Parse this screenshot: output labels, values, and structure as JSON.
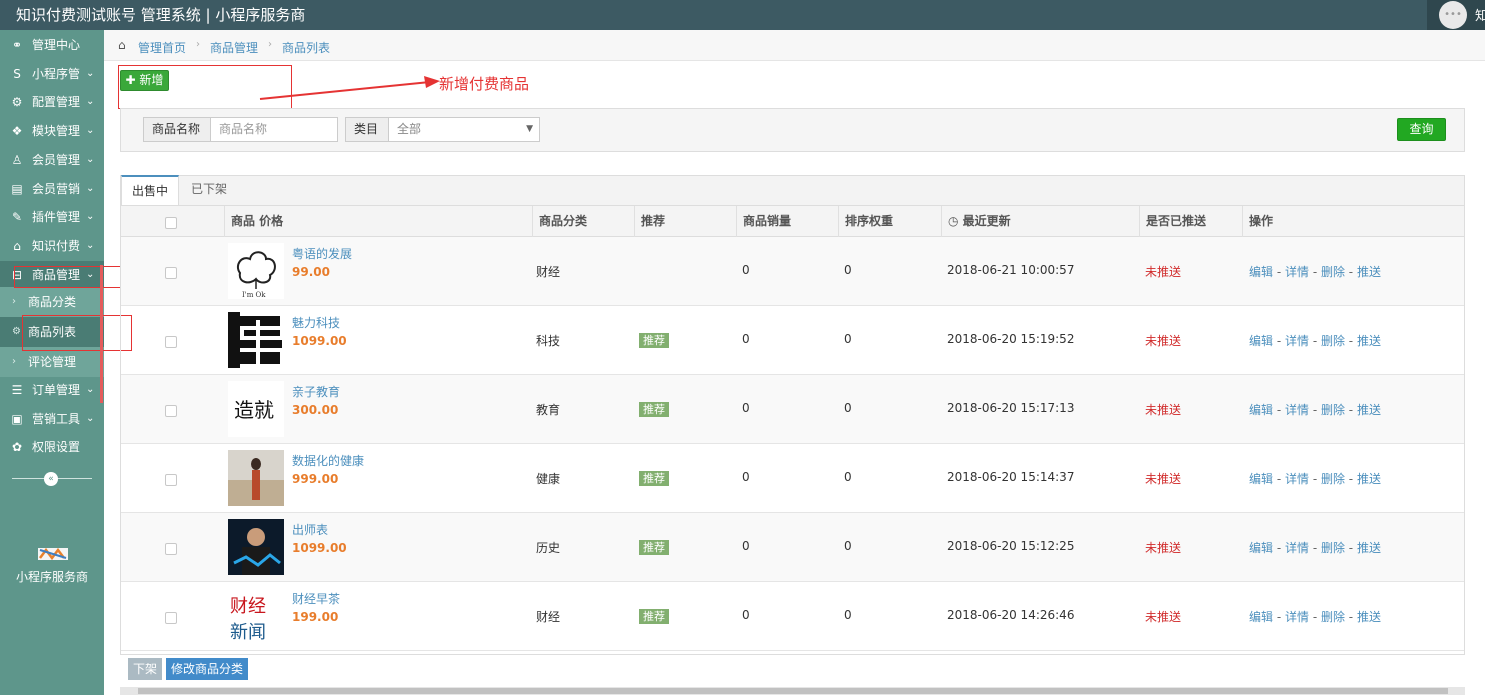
{
  "header": {
    "title": "知识付费测试账号 管理系统 | 小程序服务商",
    "user_initial": "知"
  },
  "sidebar": {
    "items": [
      {
        "label": "管理中心",
        "icon": "dashboard-icon",
        "glyph": "⚭"
      },
      {
        "label": "小程序管",
        "icon": "s-icon",
        "glyph": "S"
      },
      {
        "label": "配置管理",
        "icon": "gears-icon",
        "glyph": "⚙"
      },
      {
        "label": "模块管理",
        "icon": "cubes-icon",
        "glyph": "❖"
      },
      {
        "label": "会员管理",
        "icon": "user-icon",
        "glyph": "♙"
      },
      {
        "label": "会员营销",
        "icon": "card-icon",
        "glyph": "▤"
      },
      {
        "label": "插件管理",
        "icon": "wrench-icon",
        "glyph": "✎"
      },
      {
        "label": "知识付费",
        "icon": "home-icon",
        "glyph": "⌂"
      },
      {
        "label": "商品管理",
        "icon": "cart-icon",
        "glyph": "⊟"
      }
    ],
    "subitems": [
      {
        "label": "商品分类"
      },
      {
        "label": "商品列表"
      },
      {
        "label": "评论管理"
      }
    ],
    "items2": [
      {
        "label": "订单管理",
        "icon": "list-icon",
        "glyph": "☰"
      },
      {
        "label": "营销工具",
        "icon": "briefcase-icon",
        "glyph": "▣"
      },
      {
        "label": "权限设置",
        "icon": "cog-icon",
        "glyph": "✿"
      }
    ],
    "brand": "小程序服务商"
  },
  "breadcrumb": [
    "管理首页",
    "商品管理",
    "商品列表"
  ],
  "toolbar": {
    "add_label": "新增"
  },
  "annotation": {
    "text": "新增付费商品"
  },
  "search": {
    "name_label": "商品名称",
    "name_placeholder": "商品名称",
    "category_label": "类目",
    "category_value": "全部",
    "query_label": "查询"
  },
  "tabs": [
    "出售中",
    "已下架"
  ],
  "table": {
    "headers": [
      "商品 价格",
      "商品分类",
      "推荐",
      "商品销量",
      "排序权重",
      "最近更新",
      "是否已推送",
      "操作"
    ],
    "rows": [
      {
        "name": "粤语的发展",
        "price": "99.00",
        "category": "财经",
        "recommend": "",
        "sales": "0",
        "weight": "0",
        "updated": "2018-06-21 10:00:57",
        "pushed": "未推送",
        "thumb": "cloud"
      },
      {
        "name": "魅力科技",
        "price": "1099.00",
        "category": "科技",
        "recommend": "推荐",
        "sales": "0",
        "weight": "0",
        "updated": "2018-06-20 15:19:52",
        "pushed": "未推送",
        "thumb": "ink"
      },
      {
        "name": "亲子教育",
        "price": "300.00",
        "category": "教育",
        "recommend": "推荐",
        "sales": "0",
        "weight": "0",
        "updated": "2018-06-20 15:17:13",
        "pushed": "未推送",
        "thumb": "calligraphy"
      },
      {
        "name": "数据化的健康",
        "price": "999.00",
        "category": "健康",
        "recommend": "推荐",
        "sales": "0",
        "weight": "0",
        "updated": "2018-06-20 15:14:37",
        "pushed": "未推送",
        "thumb": "beach"
      },
      {
        "name": "出师表",
        "price": "1099.00",
        "category": "历史",
        "recommend": "推荐",
        "sales": "0",
        "weight": "0",
        "updated": "2018-06-20 15:12:25",
        "pushed": "未推送",
        "thumb": "person"
      },
      {
        "name": "财经早茶",
        "price": "199.00",
        "category": "财经",
        "recommend": "推荐",
        "sales": "0",
        "weight": "0",
        "updated": "2018-06-20 14:26:46",
        "pushed": "未推送",
        "thumb": "news"
      }
    ],
    "ops": [
      "编辑",
      "详情",
      "删除",
      "推送"
    ]
  },
  "footer": {
    "offline_label": "下架",
    "modify_label": "修改商品分类"
  },
  "thumb_text": {
    "cloud": "I'm Ok",
    "calligraphy": "造就",
    "news_1": "财经",
    "news_2": "新闻"
  }
}
